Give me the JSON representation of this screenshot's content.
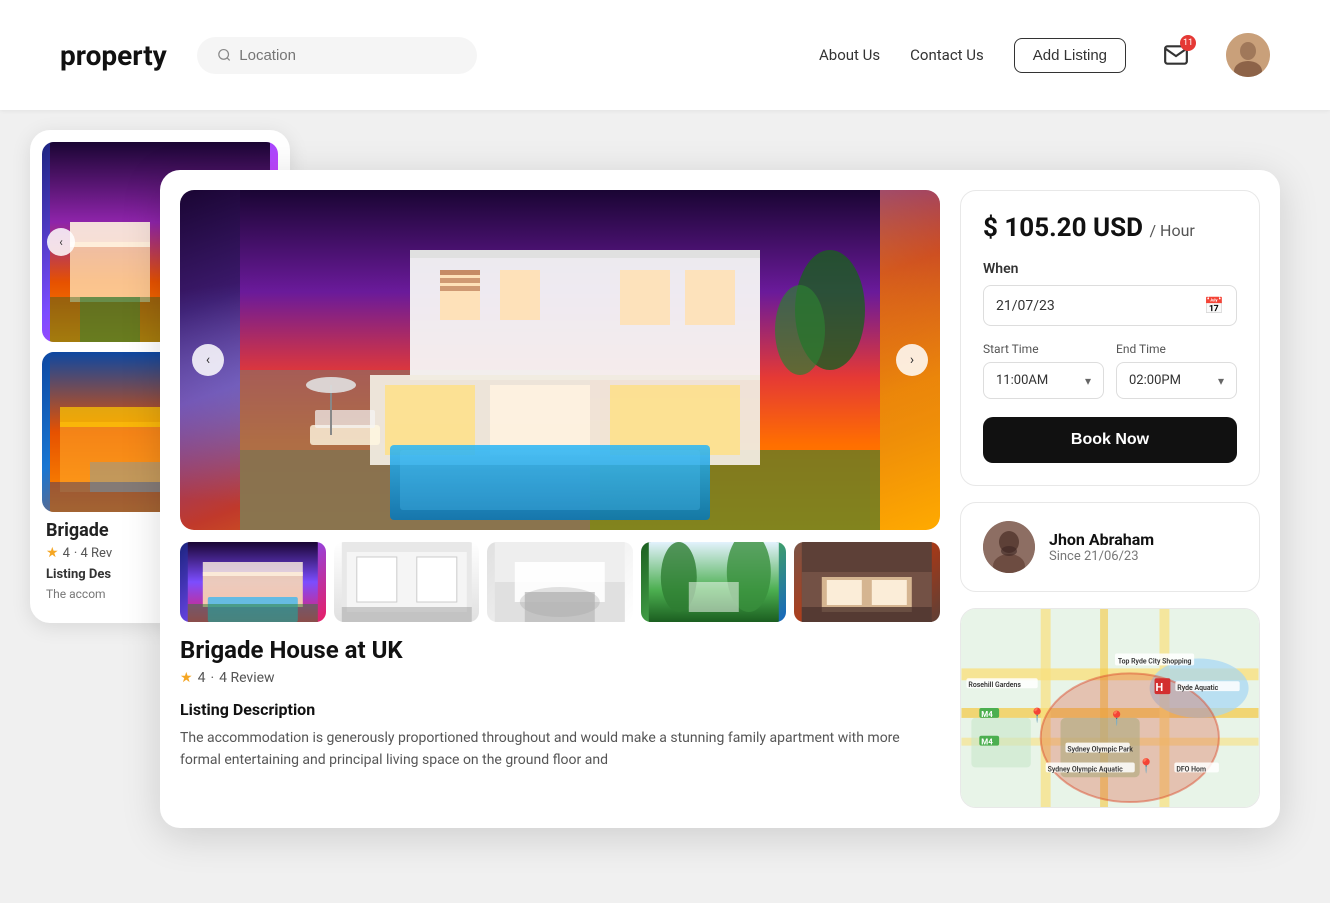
{
  "header": {
    "logo": "property",
    "search_placeholder": "Location",
    "nav": {
      "about": "About Us",
      "contact": "Contact Us",
      "add_listing": "Add Listing"
    },
    "mail_badge": "11",
    "avatar_alt": "User avatar"
  },
  "bg_card": {
    "title": "Brigade",
    "rating": "4",
    "review_count": "4 Rev",
    "section_label": "Listing Des",
    "desc_text": "The accom"
  },
  "property": {
    "title": "Brigade House at UK",
    "rating": "4",
    "review_count": "4 Review",
    "listing_desc_label": "Listing Description",
    "listing_desc_text": "The accommodation is generously proportioned throughout and would make a stunning family apartment with more formal entertaining and principal living space on the ground floor and"
  },
  "booking": {
    "price": "$ 105.20 USD",
    "price_unit": "/ Hour",
    "when_label": "When",
    "date_value": "21/07/23",
    "start_time_label": "Start Time",
    "end_time_label": "End Time",
    "start_time": "11:00AM",
    "end_time": "02:00PM",
    "book_now": "Book Now"
  },
  "host": {
    "name": "Jhon Abraham",
    "since": "Since 21/06/23"
  },
  "map": {
    "labels": [
      "Top Ryde City Shopping Centre",
      "Rosehill Gardens Racecourse",
      "Ryde Aquatic Leisure Centre",
      "Sydney Olympic Park",
      "Sydney Olympic Park Aquatic Centre",
      "DFO Hom"
    ]
  }
}
